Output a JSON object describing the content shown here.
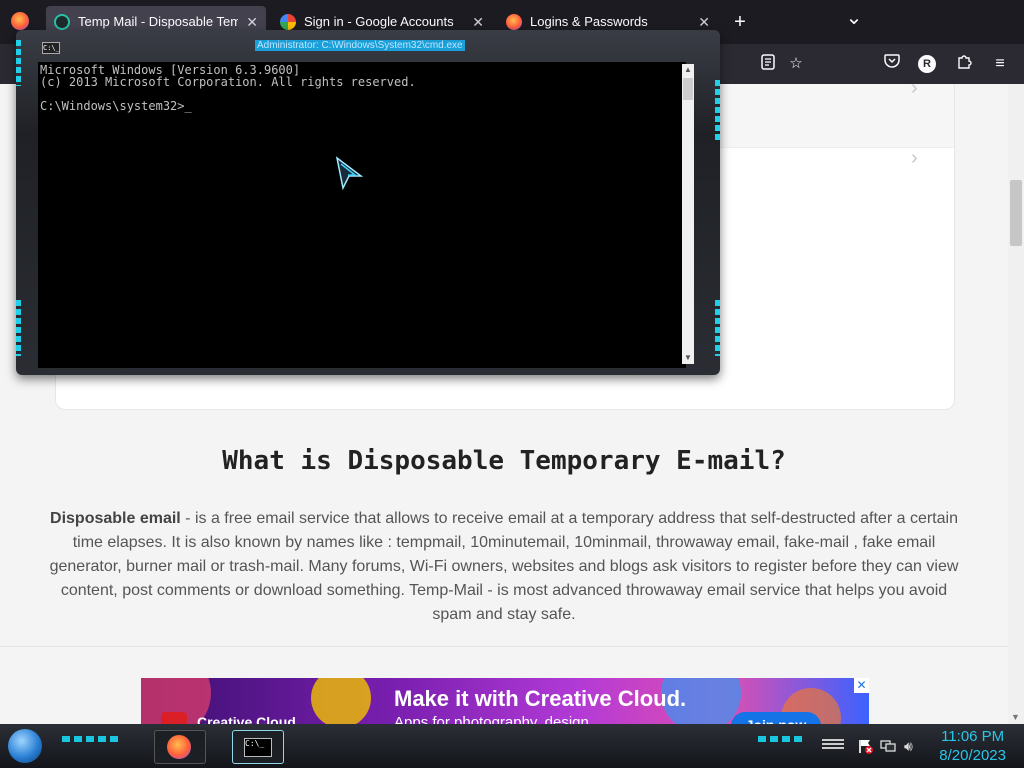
{
  "browser": {
    "tabs": [
      {
        "label": "Temp Mail - Disposable Tempo",
        "active": true,
        "icon": "temp-mail-icon"
      },
      {
        "label": "Sign in - Google Accounts",
        "active": false,
        "icon": "google-icon"
      },
      {
        "label": "Logins & Passwords",
        "active": false,
        "icon": "firefox-icon"
      }
    ],
    "tab_close": "✕",
    "new_tab": "+",
    "list_all_tabs": "⌄"
  },
  "page": {
    "heading": "What is Disposable Temporary E-mail?",
    "paragraph_bold": "Disposable email",
    "paragraph_rest": " - is a free email service that allows to receive email at a temporary address that self-destructed after a certain time elapses. It is also known by names like : tempmail, 10minutemail, 10minmail, throwaway email, fake-mail , fake email generator, burner mail or trash-mail. Many forums, Wi-Fi owners, websites and blogs ask visitors to register before they can view content, post comments or download something. Temp-Mail - is most advanced throwaway email service that helps you avoid spam and stay safe."
  },
  "ad": {
    "title": "Make it with Creative Cloud.",
    "subtitle": "Apps for photography, design,",
    "brand": "Creative Cloud",
    "cta": "Join now",
    "close": "✕"
  },
  "cmd": {
    "title": "Administrator: C:\\Windows\\System32\\cmd.exe",
    "icon_text": "C:\\_",
    "lines": [
      "Microsoft Windows [Version 6.3.9600]",
      "(c) 2013 Microsoft Corporation. All rights reserved.",
      "",
      "C:\\Windows\\system32>_"
    ]
  },
  "taskbar": {
    "time": "11:06 PM",
    "date": "8/20/2023",
    "cmd_icon_text": "C:\\_"
  },
  "colors": {
    "accent_cyan": "#20d0e8",
    "clock": "#28c6e8"
  }
}
